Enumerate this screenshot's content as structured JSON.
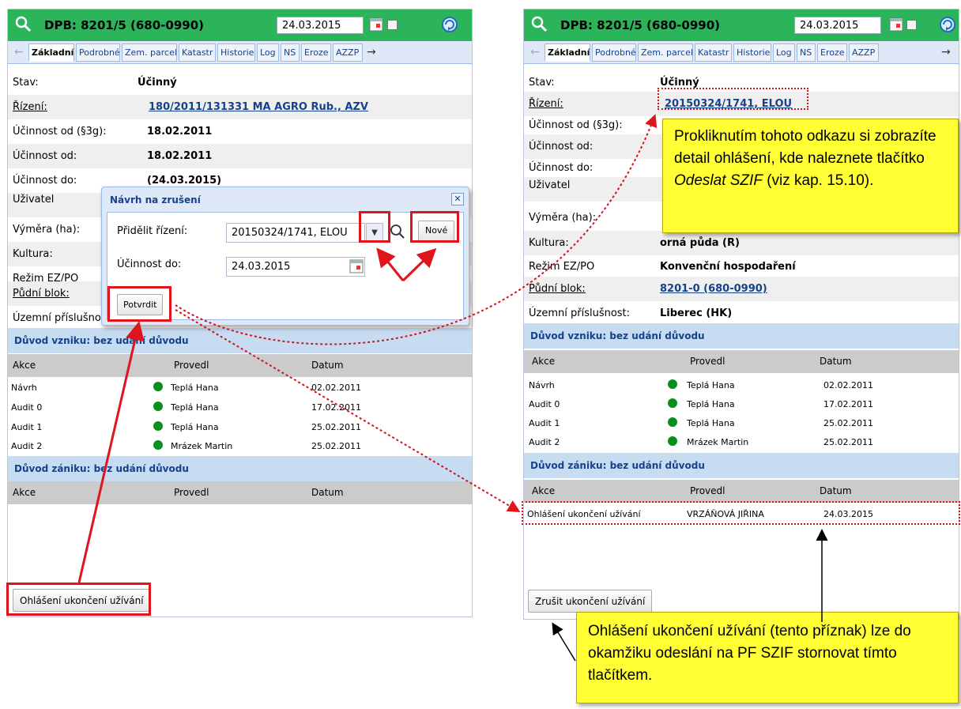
{
  "left": {
    "title": "DPB: 8201/5 (680-0990)",
    "date": "24.03.2015",
    "tabs": [
      "Základní",
      "Podrobné",
      "Zem. parcely",
      "Katastr",
      "Historie",
      "Log",
      "NS",
      "Eroze",
      "AZZP"
    ],
    "fields": {
      "stav_label": "Stav:",
      "stav_value": "Účinný",
      "rizeni_label": "Řízení:",
      "rizeni_value": "180/2011/131331 MA AGRO Rub., AZV",
      "ucinnost_3g_label": "Účinnost od (§3g):",
      "ucinnost_3g_value": "18.02.2011",
      "ucinnost_od_label": "Účinnost od:",
      "ucinnost_od_value": "18.02.2011",
      "ucinnost_do_label": "Účinnost do:",
      "ucinnost_do_value": "(24.03.2015)",
      "uzivatel_label": "Uživatel",
      "vymera_label": "Výměra (ha):",
      "kultura_label": "Kultura:",
      "rezim_label": "Režim EZ/PO",
      "pudni_label": "Půdní blok:",
      "uzemni_label": "Územní příslušnos"
    },
    "vznik_header": "Důvod vzniku: bez udání důvodu",
    "zanik_header": "Důvod zániku: bez udání důvodu",
    "cols": {
      "akce": "Akce",
      "provedl": "Provedl",
      "datum": "Datum"
    },
    "vznik_rows": [
      {
        "akce": "Návrh",
        "provedl": "Teplá Hana",
        "datum": "02.02.2011"
      },
      {
        "akce": "Audit 0",
        "provedl": "Teplá Hana",
        "datum": "17.02.2011"
      },
      {
        "akce": "Audit 1",
        "provedl": "Teplá Hana",
        "datum": "25.02.2011"
      },
      {
        "akce": "Audit 2",
        "provedl": "Mrázek Martin",
        "datum": "25.02.2011"
      }
    ],
    "bottom_button": "Ohlášení ukončení užívání"
  },
  "dialog": {
    "title": "Návrh na zrušení",
    "close": "✕",
    "prirazeni_label": "Přidělit řízení:",
    "prirazeni_value": "20150324/1741, ELOU",
    "nove_button": "Nové",
    "ucinnost_label": "Účinnost do:",
    "ucinnost_value": "24.03.2015",
    "confirm_button": "Potvrdit"
  },
  "right": {
    "title": "DPB: 8201/5 (680-0990)",
    "date": "24.03.2015",
    "tabs": [
      "Základní",
      "Podrobné",
      "Zem. parcely",
      "Katastr",
      "Historie",
      "Log",
      "NS",
      "Eroze",
      "AZZP"
    ],
    "fields": {
      "stav_label": "Stav:",
      "stav_value": "Účinný",
      "rizeni_label": "Řízení:",
      "rizeni_value": "20150324/1741, ELOU",
      "ucinnost_3g_label": "Účinnost od (§3g):",
      "ucinnost_od_label": "Účinnost od:",
      "ucinnost_do_label": "Účinnost do:",
      "uzivatel_label": "Uživatel",
      "vymera_label": "Výměra (ha):",
      "kultura_label": "Kultura:",
      "kultura_value": "orná půda (R)",
      "rezim_label": "Režim EZ/PO",
      "rezim_value": "Konvenční hospodaření",
      "pudni_label": "Půdní blok:",
      "pudni_value": "8201-0 (680-0990)",
      "uzemni_label": "Územní příslušnost:",
      "uzemni_value": "Liberec (HK)"
    },
    "vznik_header": "Důvod vzniku: bez udání důvodu",
    "zanik_header": "Důvod zániku: bez udání důvodu",
    "cols": {
      "akce": "Akce",
      "provedl": "Provedl",
      "datum": "Datum"
    },
    "vznik_rows": [
      {
        "akce": "Návrh",
        "provedl": "Teplá Hana",
        "datum": "02.02.2011"
      },
      {
        "akce": "Audit 0",
        "provedl": "Teplá Hana",
        "datum": "17.02.2011"
      },
      {
        "akce": "Audit 1",
        "provedl": "Teplá Hana",
        "datum": "25.02.2011"
      },
      {
        "akce": "Audit 2",
        "provedl": "Mrázek Martin",
        "datum": "25.02.2011"
      }
    ],
    "zanik_rows": [
      {
        "akce": "Ohlášení ukončení užívání",
        "provedl": "VRZÁŇOVÁ JIŘINA",
        "datum": "24.03.2015"
      }
    ],
    "bottom_button": "Zrušit ukončení užívání"
  },
  "notes": {
    "top_1": "Prokliknutím tohoto odkazu si zobrazíte detail ohlášení, kde naleznete tlačítko",
    "top_italic": "Odeslat SZIF",
    "top_2": "(viz kap. 15.10).",
    "bottom": "Ohlášení ukončení užívání (tento příznak) lze do okamžiku odeslání na PF SZIF stornovat tímto tlačítkem."
  },
  "colors": {
    "header_green": "#2bb45a",
    "section_blue": "#c7dbf1",
    "link_blue": "#15428b",
    "annotation_red": "#e0141c",
    "note_yellow": "#ffff33",
    "status_green": "#0b8f1b"
  }
}
